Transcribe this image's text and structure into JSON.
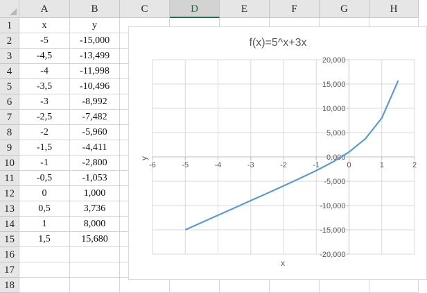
{
  "columns": [
    "A",
    "B",
    "C",
    "D",
    "E",
    "F",
    "G",
    "H"
  ],
  "selected_column": "D",
  "rows": [
    "1",
    "2",
    "3",
    "4",
    "5",
    "6",
    "7",
    "8",
    "9",
    "10",
    "11",
    "12",
    "13",
    "14",
    "15",
    "16",
    "17",
    "18"
  ],
  "cells": [
    [
      "x",
      "y"
    ],
    [
      "-5",
      "-15,000"
    ],
    [
      "-4,5",
      "-13,499"
    ],
    [
      "-4",
      "-11,998"
    ],
    [
      "-3,5",
      "-10,496"
    ],
    [
      "-3",
      "-8,992"
    ],
    [
      "-2,5",
      "-7,482"
    ],
    [
      "-2",
      "-5,960"
    ],
    [
      "-1,5",
      "-4,411"
    ],
    [
      "-1",
      "-2,800"
    ],
    [
      "-0,5",
      "-1,053"
    ],
    [
      "0",
      "1,000"
    ],
    [
      "0,5",
      "3,736"
    ],
    [
      "1",
      "8,000"
    ],
    [
      "1,5",
      "15,680"
    ]
  ],
  "chart_data": {
    "type": "line",
    "title": "f(x)=5^x+3x",
    "xlabel": "x",
    "ylabel": "y",
    "xlim": [
      -6,
      2
    ],
    "ylim": [
      -20000,
      20000
    ],
    "x_ticks": [
      "-6",
      "-5",
      "-4",
      "-3",
      "-2",
      "-1",
      "0",
      "1",
      "2"
    ],
    "y_ticks": [
      "20,000",
      "15,000",
      "10,000",
      "5,000",
      "0,000",
      "-5,000",
      "-10,000",
      "-15,000",
      "-20,000"
    ],
    "grid": true,
    "line_color": "#5b9bd5",
    "series": [
      {
        "x": [
          -5,
          -4.5,
          -4,
          -3.5,
          -3,
          -2.5,
          -2,
          -1.5,
          -1,
          -0.5,
          0,
          0.5,
          1,
          1.5
        ],
        "values": [
          -15000,
          -13499,
          -11998,
          -10496,
          -8992,
          -7482,
          -5960,
          -4411,
          -2800,
          -1053,
          1000,
          3736,
          8000,
          15680
        ]
      }
    ]
  }
}
